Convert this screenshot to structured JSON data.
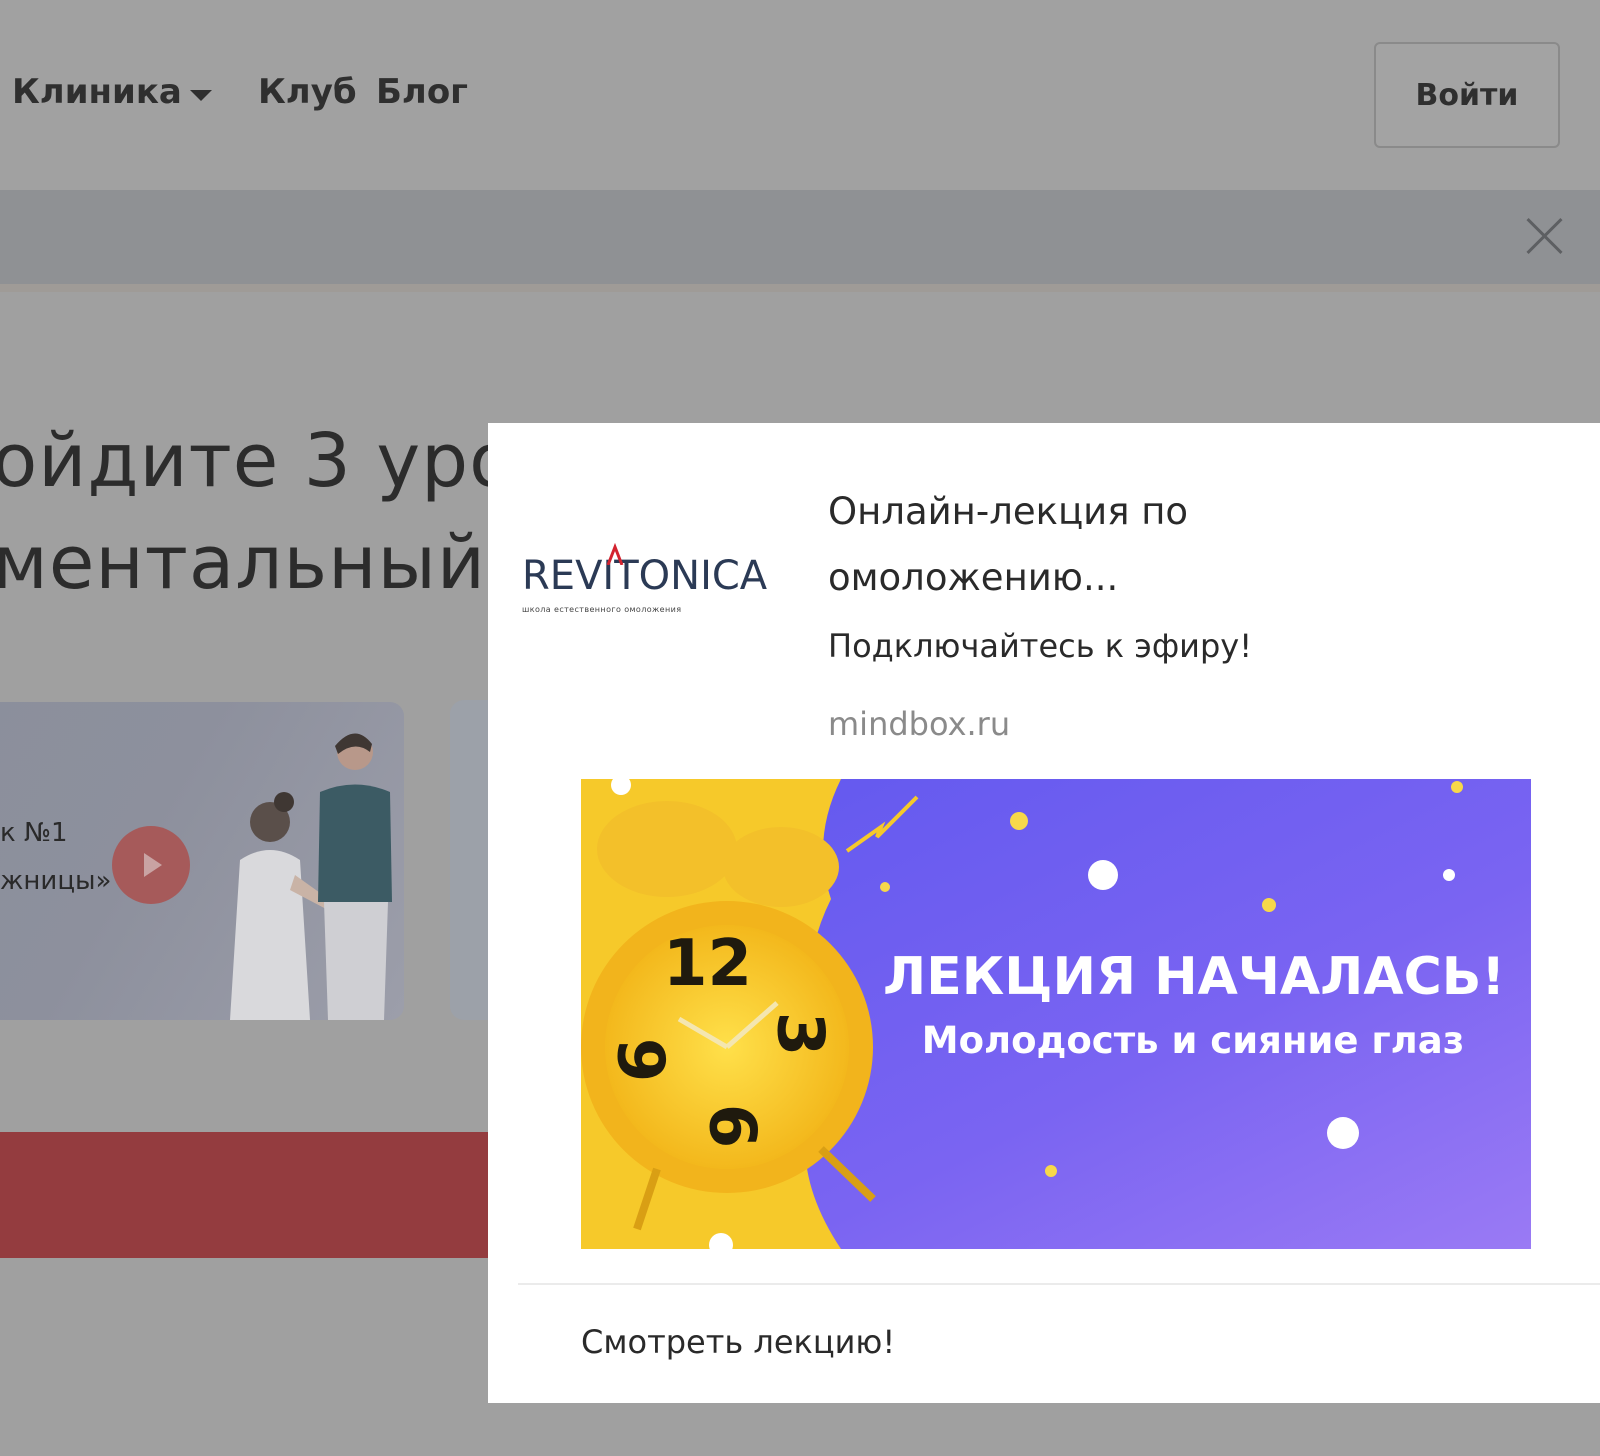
{
  "nav": {
    "items": [
      "Клиника",
      "Клуб",
      "Блог"
    ],
    "login_label": "Войти"
  },
  "hero": {
    "line1": "ойдите 3 уро",
    "line2": "ментальный"
  },
  "lesson_card": {
    "label_line1": "к №1",
    "label_line2": "жницы»"
  },
  "notification": {
    "brand_logo": "REVITONICA",
    "brand_tagline": "школа естественного омоложения",
    "title": "Онлайн-лекция по омоложению...",
    "body": "Подключайтесь к эфиру!",
    "domain": "mindbox.ru",
    "image": {
      "headline": "ЛЕКЦИЯ НАЧАЛАСЬ!",
      "subline": "Молодость и сияние глаз",
      "clock_numbers": [
        "12",
        "3",
        "6",
        "9"
      ]
    },
    "action_label": "Смотреть лекцию!"
  },
  "icons": {
    "caret": "chevron-down-icon",
    "close": "close-icon",
    "play": "play-icon",
    "clock": "alarm-clock-icon"
  },
  "colors": {
    "overlay_bg": "#a0a0a0",
    "logo_blue": "#2b3a55",
    "logo_red": "#d3232f",
    "image_purple": "#6b5ff0",
    "image_yellow": "#f6c92a",
    "muted_text": "#8a8a8a"
  }
}
